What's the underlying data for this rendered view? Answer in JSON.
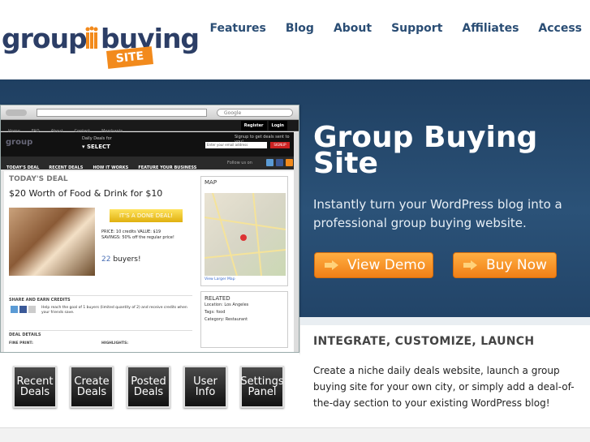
{
  "logo": {
    "word1": "group",
    "word2": "buying",
    "badge": "SITE"
  },
  "nav": [
    "Features",
    "Blog",
    "About",
    "Support",
    "Affiliates",
    "Access"
  ],
  "hero": {
    "title": "Group Buying Site",
    "subtitle": "Instantly turn your WordPress blog into a professional group buying website.",
    "demo_label": "View Demo",
    "buy_label": "Buy Now"
  },
  "browser": {
    "search_placeholder": "Google",
    "topnav": [
      "Home",
      "FAQ",
      "About",
      "Contact",
      "Merchants"
    ],
    "auth": [
      "Register",
      "Login"
    ],
    "daily_label": "Daily Deals for",
    "select_label": "▾ SELECT",
    "signup_text": "Signup to get deals sent to you!",
    "email_placeholder": "Enter your email address",
    "signup_btn": "SIGNUP",
    "menu": [
      "TODAY'S DEAL",
      "RECENT DEALS",
      "HOW IT WORKS",
      "FEATURE YOUR BUSINESS"
    ],
    "follow": "Follow us on",
    "deal_label": "TODAY'S DEAL",
    "deal_title": "$20 Worth of Food & Drink for $10",
    "done_label": "IT'S A DONE DEAL!",
    "price_line": "PRICE: 10 credits   VALUE: $19",
    "savings_line": "SAVINGS: 50% off the regular price!",
    "buyers_count": "22",
    "buyers_label": "buyers!",
    "share_label": "SHARE AND EARN CREDITS",
    "share_text": "Help reach the goal of 1 buyers (limited quantity of 2) and receive credits when your friends save.",
    "details_label": "DEAL DETAILS",
    "fine_print": "FINE PRINT:",
    "highlights": "HIGHLIGHTS:",
    "map_label": "MAP",
    "map_link": "View Larger Map",
    "related_label": "RELATED",
    "location": "Location: Los Angeles",
    "tags": "Tags: food",
    "category": "Category: Restaurant"
  },
  "features": [
    "Recent Deals",
    "Create Deals",
    "Posted Deals",
    "User Info",
    "Settings Panel"
  ],
  "intro": {
    "heading": "INTEGRATE, CUSTOMIZE, LAUNCH",
    "body": "Create a niche daily deals website, launch a group buying site for your own city, or simply add a deal-of-the-day section to your existing WordPress blog!"
  },
  "colors": {
    "brand": "#2c3e66",
    "accent": "#f28a1c",
    "hero": "#1f3f61"
  }
}
